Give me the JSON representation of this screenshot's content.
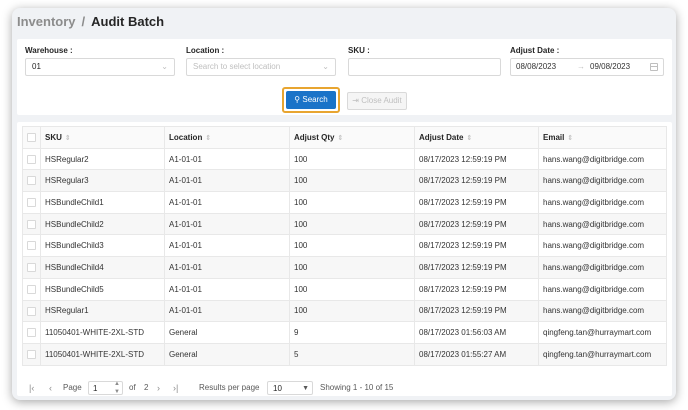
{
  "breadcrumb": {
    "parent": "Inventory",
    "separator": "/",
    "current": "Audit Batch"
  },
  "filters": {
    "warehouse": {
      "label": "Warehouse :",
      "value": "01"
    },
    "location": {
      "label": "Location :",
      "placeholder": "Search to select location"
    },
    "sku": {
      "label": "SKU :",
      "value": ""
    },
    "adjust_date": {
      "label": "Adjust Date :",
      "from": "08/08/2023",
      "arrow": "→",
      "to": "09/08/2023"
    }
  },
  "buttons": {
    "search": "Search",
    "close_audit": "Close Audit"
  },
  "table": {
    "columns": [
      "SKU",
      "Location",
      "Adjust Qty",
      "Adjust Date",
      "Email"
    ],
    "rows": [
      [
        "HSRegular2",
        "A1-01-01",
        "100",
        "08/17/2023 12:59:19 PM",
        "hans.wang@digitbridge.com"
      ],
      [
        "HSRegular3",
        "A1-01-01",
        "100",
        "08/17/2023 12:59:19 PM",
        "hans.wang@digitbridge.com"
      ],
      [
        "HSBundleChild1",
        "A1-01-01",
        "100",
        "08/17/2023 12:59:19 PM",
        "hans.wang@digitbridge.com"
      ],
      [
        "HSBundleChild2",
        "A1-01-01",
        "100",
        "08/17/2023 12:59:19 PM",
        "hans.wang@digitbridge.com"
      ],
      [
        "HSBundleChild3",
        "A1-01-01",
        "100",
        "08/17/2023 12:59:19 PM",
        "hans.wang@digitbridge.com"
      ],
      [
        "HSBundleChild4",
        "A1-01-01",
        "100",
        "08/17/2023 12:59:19 PM",
        "hans.wang@digitbridge.com"
      ],
      [
        "HSBundleChild5",
        "A1-01-01",
        "100",
        "08/17/2023 12:59:19 PM",
        "hans.wang@digitbridge.com"
      ],
      [
        "HSRegular1",
        "A1-01-01",
        "100",
        "08/17/2023 12:59:19 PM",
        "hans.wang@digitbridge.com"
      ],
      [
        "11050401-WHITE-2XL-STD",
        "General",
        "9",
        "08/17/2023 01:56:03 AM",
        "qingfeng.tan@hurraymart.com"
      ],
      [
        "11050401-WHITE-2XL-STD",
        "General",
        "5",
        "08/17/2023 01:55:27 AM",
        "qingfeng.tan@hurraymart.com"
      ]
    ]
  },
  "pagination": {
    "page_label": "Page",
    "current_page": "1",
    "of_label": "of",
    "total_pages": "2",
    "rows_per_page_label": "Results per page",
    "rows_per_page": "10",
    "showing": "Showing 1 - 10 of 15"
  },
  "colors": {
    "primary": "#1a73c8",
    "highlight": "#e8a530",
    "background": "#f0f2f5"
  }
}
